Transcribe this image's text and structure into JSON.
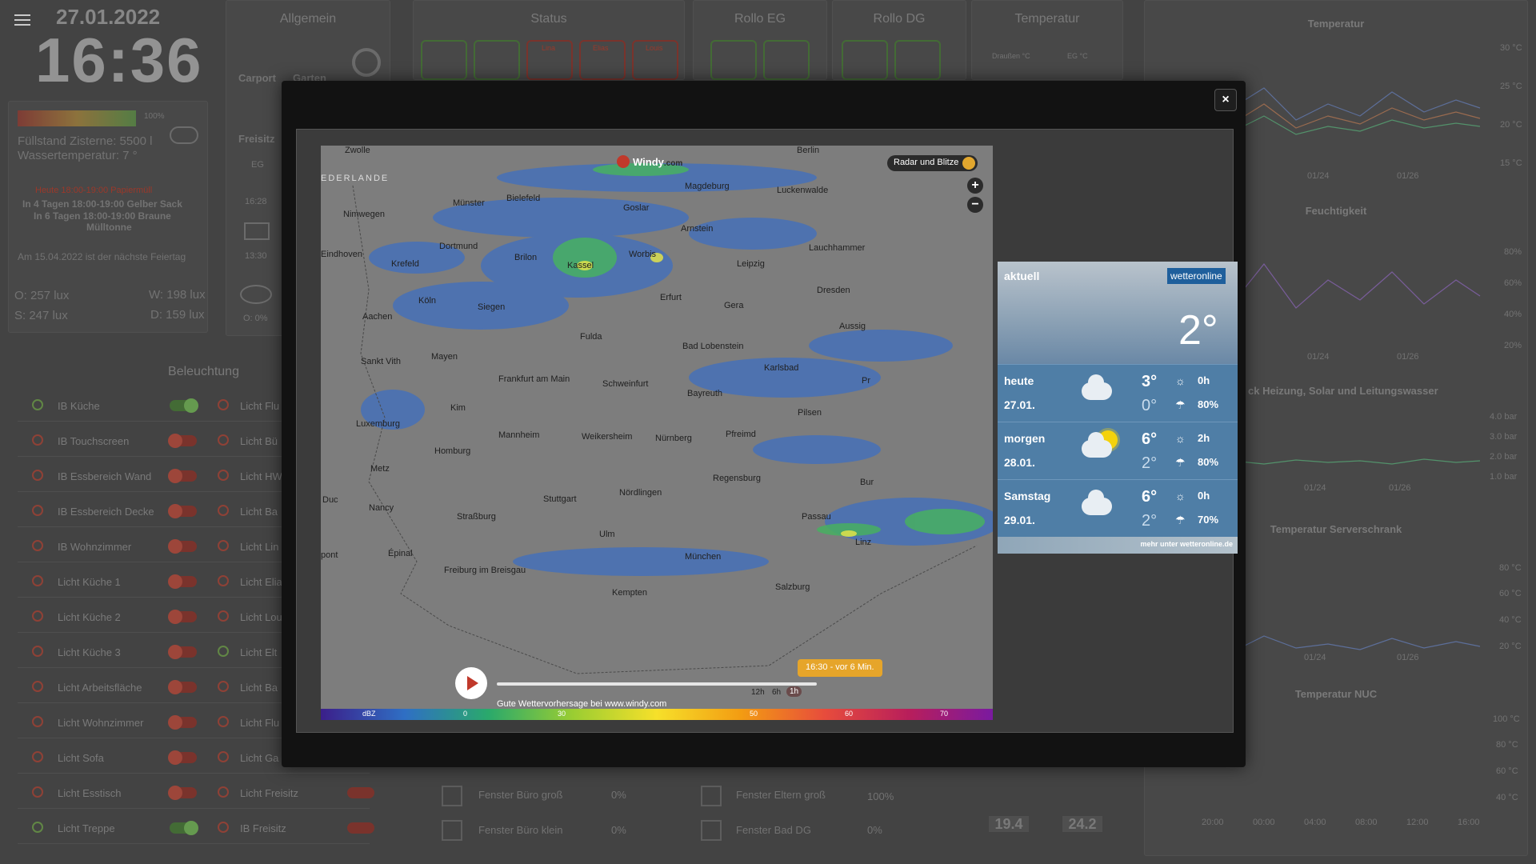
{
  "header": {
    "date": "27.01.2022",
    "time": "16:36"
  },
  "info": {
    "gauge_pct": "100%",
    "cistern": "Füllstand Zisterne: 5500 l",
    "water_temp": "Wassertemperatur: 7 °",
    "waste_today": "Heute 18:00-19:00 Papiermüll",
    "waste_4": "In 4 Tagen 18:00-19:00 Gelber Sack",
    "waste_6a": "In 6 Tagen 18:00-19:00 Braune",
    "waste_6b": "Mülltonne",
    "holiday": "Am 15.04.2022 ist der nächste Feiertag",
    "lux_o": "O: 257 lux",
    "lux_w": "W: 198 lux",
    "lux_s": "S: 247 lux",
    "lux_d": "D: 159 lux"
  },
  "sections": {
    "allgemein": "Allgemein",
    "status": "Status",
    "rollo_eg": "Rollo EG",
    "rollo_dg": "Rollo DG",
    "temperatur": "Temperatur",
    "beleuchtung": "Beleuchtung"
  },
  "allgemein": {
    "carport": "Carport",
    "garten": "Garten",
    "freisitz": "Freisitz",
    "eg": "EG",
    "t1": "16:28",
    "t2": "13:30",
    "o": "O: 0%"
  },
  "temp_small": {
    "draussen": "Draußen °C",
    "eg": "EG °C",
    "v1": "19.4",
    "v2": "24.2"
  },
  "charts": {
    "temp": "Temperatur",
    "feucht": "Feuchtigkeit",
    "druck": "ck Heizung, Solar und Leitungswasser",
    "server": "Temperatur Serverschrank",
    "nuc": "Temperatur NUC",
    "temp_ticks": [
      "30 °C",
      "25 °C",
      "20 °C",
      "15 °C"
    ],
    "feucht_ticks": [
      "80%",
      "60%",
      "40%",
      "20%"
    ],
    "druck_ticks": [
      "4.0 bar",
      "3.0 bar",
      "2.0 bar",
      "1.0 bar"
    ],
    "server_ticks": [
      "80 °C",
      "60 °C",
      "40 °C",
      "20 °C"
    ],
    "nuc_ticks": [
      "100 °C",
      "80 °C",
      "60 °C",
      "40 °C"
    ],
    "d1": "01/24",
    "d2": "01/26",
    "nuc_x": [
      "20:00",
      "00:00",
      "04:00",
      "08:00",
      "12:00",
      "16:00"
    ]
  },
  "lights": [
    {
      "l": "IB Küche",
      "r": "Licht Flu"
    },
    {
      "l": "IB Touchscreen",
      "r": "Licht Bü"
    },
    {
      "l": "IB Essbereich Wand",
      "r": "Licht HW"
    },
    {
      "l": "IB Essbereich Decke",
      "r": "Licht Ba"
    },
    {
      "l": "IB Wohnzimmer",
      "r": "Licht Lin"
    },
    {
      "l": "Licht Küche 1",
      "r": "Licht Elia"
    },
    {
      "l": "Licht Küche 2",
      "r": "Licht Lou"
    },
    {
      "l": "Licht Küche 3",
      "r": "Licht Elt"
    },
    {
      "l": "Licht Arbeitsfläche",
      "r": "Licht Ba"
    },
    {
      "l": "Licht Wohnzimmer",
      "r": "Licht Flu"
    },
    {
      "l": "Licht Sofa",
      "r": "Licht Ga"
    },
    {
      "l": "Licht Esstisch",
      "r": "Licht Freisitz"
    },
    {
      "l": "Licht Treppe",
      "r": "IB Freisitz"
    }
  ],
  "windows": {
    "w1": "Fenster Büro groß",
    "p1": "0%",
    "w2": "Fenster Eltern groß",
    "p2": "100%",
    "w3": "Fenster Büro klein",
    "p3": "0%",
    "w4": "Fenster Bad DG",
    "p4": "0%"
  },
  "status_people": [
    "Lina",
    "Elias",
    "Louis"
  ],
  "modal": {
    "close": "×"
  },
  "map": {
    "brand": "Windy",
    "brand_suffix": ".com",
    "layer": "Radar und Blitze",
    "zoom_in": "+",
    "zoom_out": "−",
    "time_label": "16:30 - vor 6 Min.",
    "t12": "12h",
    "t6": "6h",
    "t1": "1h",
    "footer": "Gute Wettervorhersage bei www.windy.com",
    "legend": [
      "dBZ",
      "0",
      "30",
      "50",
      "60",
      "70"
    ],
    "cities": [
      "Zwolle",
      "Berlin",
      "EDERLANDE",
      "Magdeburg",
      "Luckenwalde",
      "Bielefeld",
      "Münster",
      "Nimwegen",
      "Goslar",
      "Arnstein",
      "Dortmund",
      "Lauchhammer",
      "Eindhoven",
      "Brilon",
      "Kassel",
      "Worbis",
      "Leipzig",
      "Krefeld",
      "Köln",
      "Siegen",
      "Erfurt",
      "Gera",
      "Dresden",
      "Aachen",
      "Aussig",
      "Fulda",
      "Bad Lobenstein",
      "Sankt Vith",
      "Mayen",
      "Frankfurt am Main",
      "Schweinfurt",
      "Karlsbad",
      "Pr",
      "Bayreuth",
      "Kim",
      "Pilsen",
      "Luxemburg",
      "Mannheim",
      "Weikersheim",
      "Nürnberg",
      "Pfreimd",
      "Homburg",
      "Metz",
      "Bur",
      "Regensburg",
      "Duc",
      "Stuttgart",
      "Nördlingen",
      "Nancy",
      "Straßburg",
      "Passau",
      "Ulm",
      "Linz",
      "Épinal",
      "München",
      "Freiburg im Breisgau",
      "Kempten",
      "Salzburg",
      "pont"
    ]
  },
  "wetteronline": {
    "aktuell": "aktuell",
    "brand": "wetteronline",
    "now": "2°",
    "more": "mehr unter wetteronline.de",
    "days": [
      {
        "name": "heute",
        "date": "27.01.",
        "max": "3°",
        "min": "0°",
        "sun": "0h",
        "rain": "80%"
      },
      {
        "name": "morgen",
        "date": "28.01.",
        "max": "6°",
        "min": "2°",
        "sun": "2h",
        "rain": "80%"
      },
      {
        "name": "Samstag",
        "date": "29.01.",
        "max": "6°",
        "min": "2°",
        "sun": "0h",
        "rain": "70%"
      }
    ]
  }
}
